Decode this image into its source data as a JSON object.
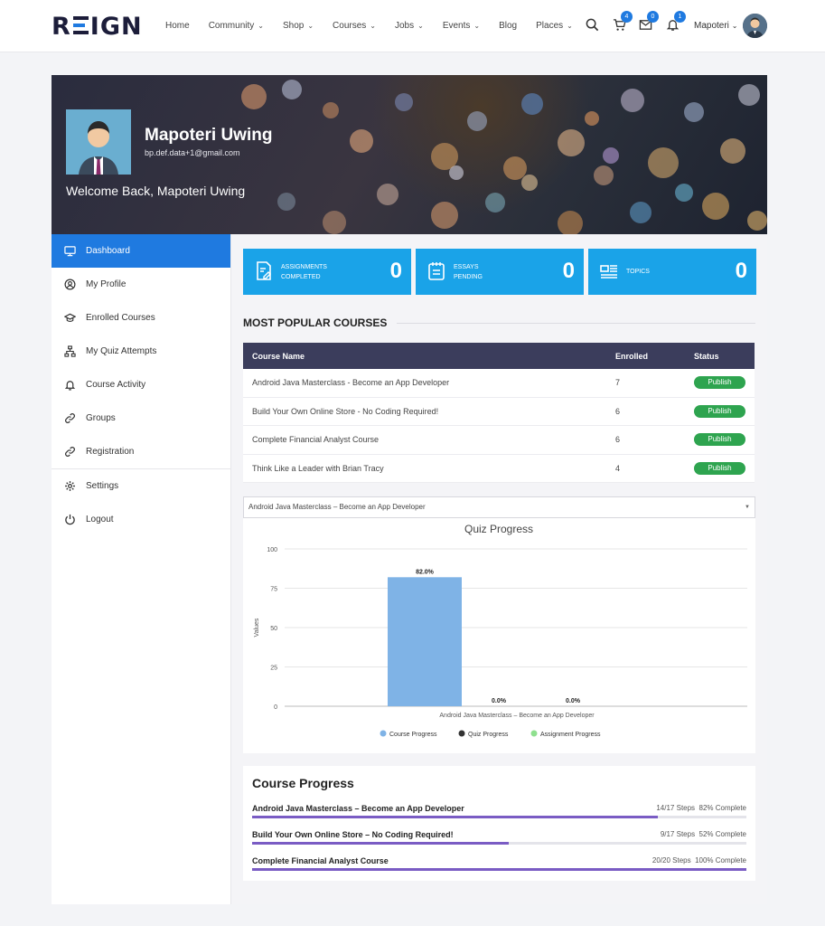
{
  "brand": {
    "logo_left": "R",
    "logo_right": "IGN"
  },
  "nav": {
    "items": [
      {
        "label": "Home",
        "dropdown": false
      },
      {
        "label": "Community",
        "dropdown": true
      },
      {
        "label": "Shop",
        "dropdown": true
      },
      {
        "label": "Courses",
        "dropdown": true
      },
      {
        "label": "Jobs",
        "dropdown": true
      },
      {
        "label": "Events",
        "dropdown": true
      },
      {
        "label": "Blog",
        "dropdown": false
      },
      {
        "label": "Places",
        "dropdown": true
      }
    ],
    "cart_count": "4",
    "messages_count": "0",
    "notifications_count": "1",
    "user_name": "Mapoteri"
  },
  "profile": {
    "name": "Mapoteri Uwing",
    "email": "bp.def.data+1@gmail.com",
    "welcome": "Welcome Back, Mapoteri Uwing"
  },
  "sidebar": {
    "items": [
      {
        "label": "Dashboard",
        "icon": "monitor-icon",
        "active": true
      },
      {
        "label": "My Profile",
        "icon": "user-circle-icon"
      },
      {
        "label": "Enrolled Courses",
        "icon": "graduation-cap-icon"
      },
      {
        "label": "My Quiz Attempts",
        "icon": "sitemap-icon"
      },
      {
        "label": "Course Activity",
        "icon": "bell-icon"
      },
      {
        "label": "Groups",
        "icon": "link-icon"
      },
      {
        "label": "Registration",
        "icon": "link-icon"
      },
      {
        "label": "Settings",
        "icon": "gear-icon"
      },
      {
        "label": "Logout",
        "icon": "power-icon"
      }
    ]
  },
  "stats": [
    {
      "label_line1": "Assignments",
      "label_line2": "Completed",
      "value": "0",
      "icon": "assignment-icon"
    },
    {
      "label_line1": "Essays",
      "label_line2": "Pending",
      "value": "0",
      "icon": "notepad-icon"
    },
    {
      "label_line1": "Topics",
      "label_line2": "",
      "value": "0",
      "icon": "topics-icon"
    }
  ],
  "popular": {
    "title": "MOST POPULAR COURSES",
    "headers": [
      "Course Name",
      "Enrolled",
      "Status"
    ],
    "rows": [
      {
        "name": "Android Java Masterclass - Become an App Developer",
        "enrolled": "7",
        "status": "Publish"
      },
      {
        "name": "Build Your Own Online Store - No Coding Required!",
        "enrolled": "6",
        "status": "Publish"
      },
      {
        "name": "Complete Financial Analyst Course",
        "enrolled": "6",
        "status": "Publish"
      },
      {
        "name": "Think Like a Leader with Brian Tracy",
        "enrolled": "4",
        "status": "Publish"
      }
    ]
  },
  "course_select": {
    "value": "Android Java Masterclass – Become an App Developer"
  },
  "chart_data": {
    "type": "bar",
    "title": "Quiz Progress",
    "ylabel": "Values",
    "xlabel": "",
    "categories": [
      "Android Java Masterclass – Become an App Developer"
    ],
    "ylim": [
      0,
      100
    ],
    "yticks": [
      0,
      25,
      50,
      75,
      100
    ],
    "grid": true,
    "legend_position": "bottom",
    "series": [
      {
        "name": "Course Progress",
        "values": [
          82.0
        ],
        "label": "82.0%",
        "color": "#7fb3e6"
      },
      {
        "name": "Quiz Progress",
        "values": [
          0.0
        ],
        "label": "0.0%",
        "color": "#333333"
      },
      {
        "name": "Assignment Progress",
        "values": [
          0.0
        ],
        "label": "0.0%",
        "color": "#8fe08f"
      }
    ]
  },
  "course_progress": {
    "title": "Course Progress",
    "items": [
      {
        "name": "Android Java Masterclass – Become an App Developer",
        "steps": "14/17 Steps",
        "percent_text": "82% Complete",
        "percent": 82
      },
      {
        "name": "Build Your Own Online Store – No Coding Required!",
        "steps": "9/17 Steps",
        "percent_text": "52% Complete",
        "percent": 52
      },
      {
        "name": "Complete Financial Analyst Course",
        "steps": "20/20 Steps",
        "percent_text": "100% Complete",
        "percent": 100
      }
    ]
  }
}
